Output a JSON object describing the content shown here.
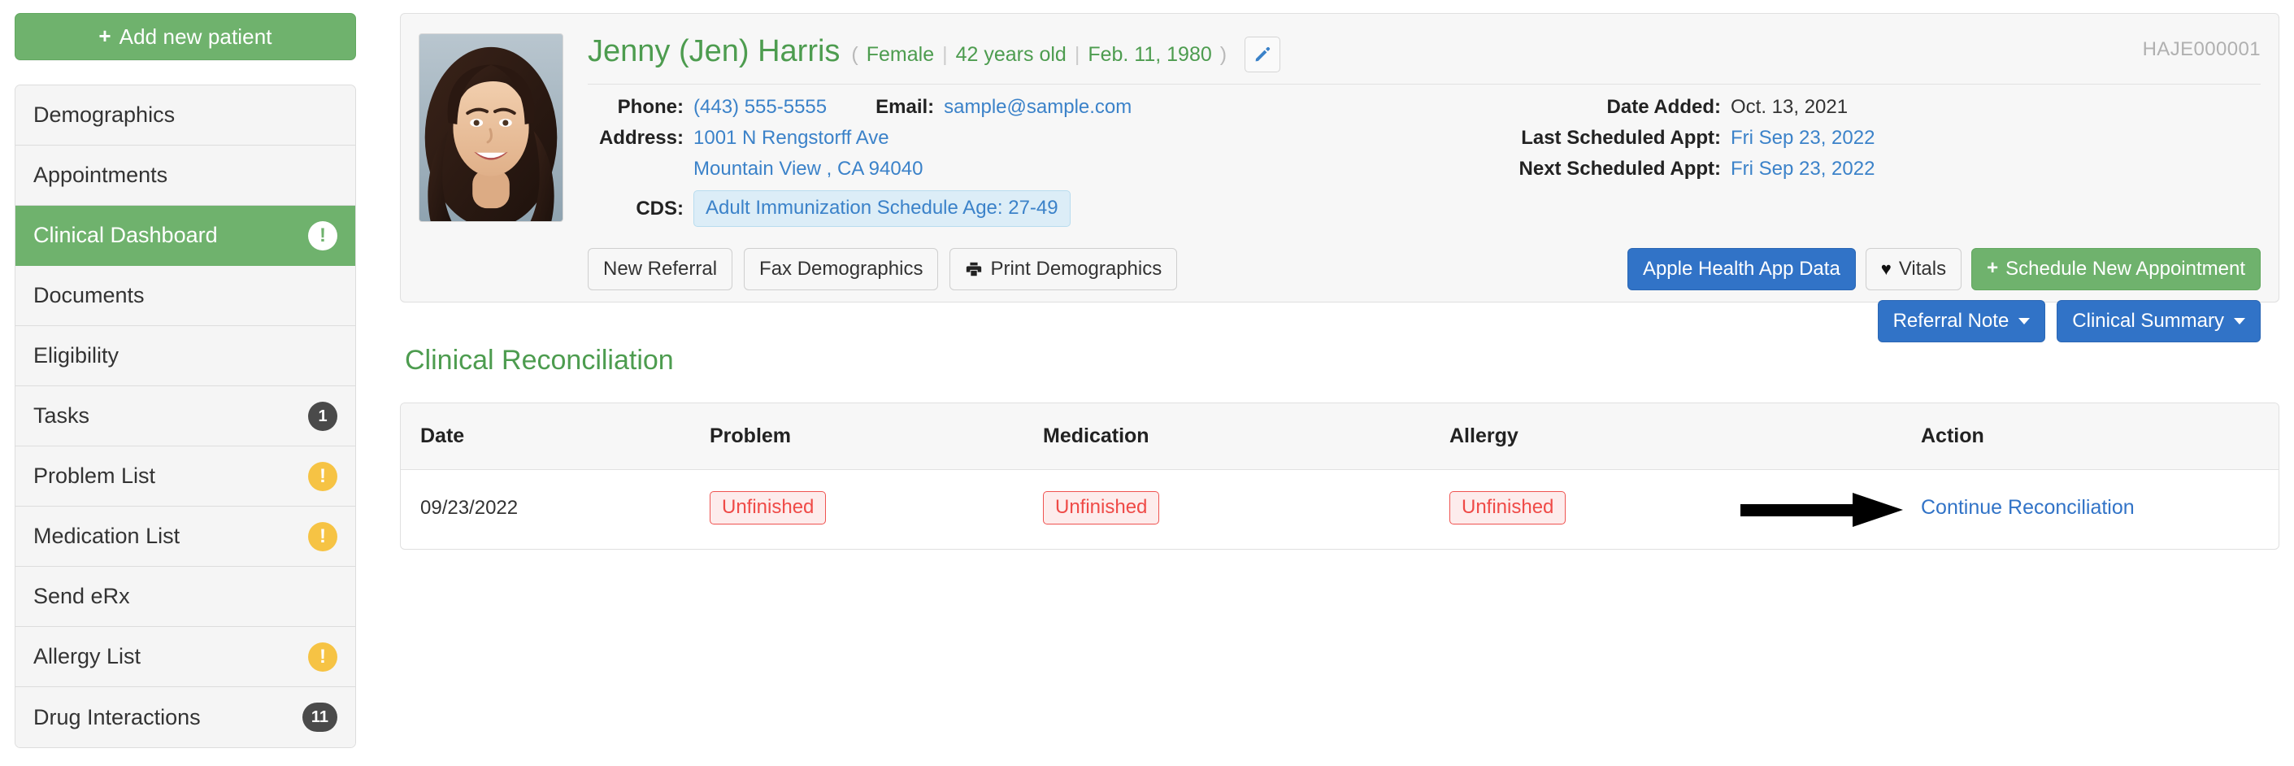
{
  "sidebar": {
    "add_patient_label": "Add new patient",
    "add_patient_icon": "plus-icon",
    "items": [
      {
        "label": "Demographics",
        "badge": null,
        "badge_type": null,
        "active": false
      },
      {
        "label": "Appointments",
        "badge": null,
        "badge_type": null,
        "active": false
      },
      {
        "label": "Clinical Dashboard",
        "badge": "!",
        "badge_type": "warn-on-green",
        "active": true
      },
      {
        "label": "Documents",
        "badge": null,
        "badge_type": null,
        "active": false
      },
      {
        "label": "Eligibility",
        "badge": null,
        "badge_type": null,
        "active": false
      },
      {
        "label": "Tasks",
        "badge": "1",
        "badge_type": "count",
        "active": false
      },
      {
        "label": "Problem List",
        "badge": "!",
        "badge_type": "warn",
        "active": false
      },
      {
        "label": "Medication List",
        "badge": "!",
        "badge_type": "warn",
        "active": false
      },
      {
        "label": "Send eRx",
        "badge": null,
        "badge_type": null,
        "active": false
      },
      {
        "label": "Allergy List",
        "badge": "!",
        "badge_type": "warn",
        "active": false
      },
      {
        "label": "Drug Interactions",
        "badge": "11",
        "badge_type": "count",
        "active": false
      }
    ]
  },
  "patient": {
    "name": "Jenny (Jen) Harris",
    "paren_open": "(",
    "paren_close": ")",
    "gender": "Female",
    "age": "42 years old",
    "dob": "Feb. 11, 1980",
    "separator": "|",
    "edit_icon": "pencil-icon",
    "patient_id": "HAJE000001",
    "photo_alt": "patient-photo",
    "phone_label": "Phone:",
    "phone": "(443) 555-5555",
    "email_label": "Email:",
    "email": "sample@sample.com",
    "address_label": "Address:",
    "address_line1": "1001 N Rengstorff Ave",
    "address_line2": "Mountain View , CA 94040",
    "cds_label": "CDS:",
    "cds_value": "Adult Immunization Schedule Age: 27-49",
    "date_added_label": "Date Added:",
    "date_added": "Oct. 13, 2021",
    "last_appt_label": "Last Scheduled Appt:",
    "last_appt": "Fri Sep 23, 2022",
    "next_appt_label": "Next Scheduled Appt:",
    "next_appt": "Fri Sep 23, 2022"
  },
  "actions": {
    "new_referral": "New Referral",
    "fax_demographics": "Fax Demographics",
    "print_demographics": "Print Demographics",
    "print_icon": "printer-icon",
    "apple_health": "Apple Health App Data",
    "vitals": "Vitals",
    "vitals_icon": "heart-icon",
    "schedule_appointment": "Schedule New Appointment",
    "schedule_icon": "plus-icon",
    "referral_note": "Referral Note",
    "clinical_summary": "Clinical Summary",
    "dropdown_icon": "chevron-down-icon"
  },
  "reconciliation": {
    "title": "Clinical Reconciliation",
    "columns": [
      "Date",
      "Problem",
      "Medication",
      "Allergy",
      "Action"
    ],
    "rows": [
      {
        "date": "09/23/2022",
        "problem": "Unfinished",
        "medication": "Unfinished",
        "allergy": "Unfinished",
        "action": "Continue Reconciliation"
      }
    ],
    "annotation_icon": "right-arrow-annotation"
  },
  "colors": {
    "brand_green": "#6fb26d",
    "name_green": "#4d9c4f",
    "link_blue": "#3173c7",
    "danger_red": "#ef5350",
    "warn_yellow": "#f6c344",
    "badge_dark": "#4a4a4a"
  }
}
